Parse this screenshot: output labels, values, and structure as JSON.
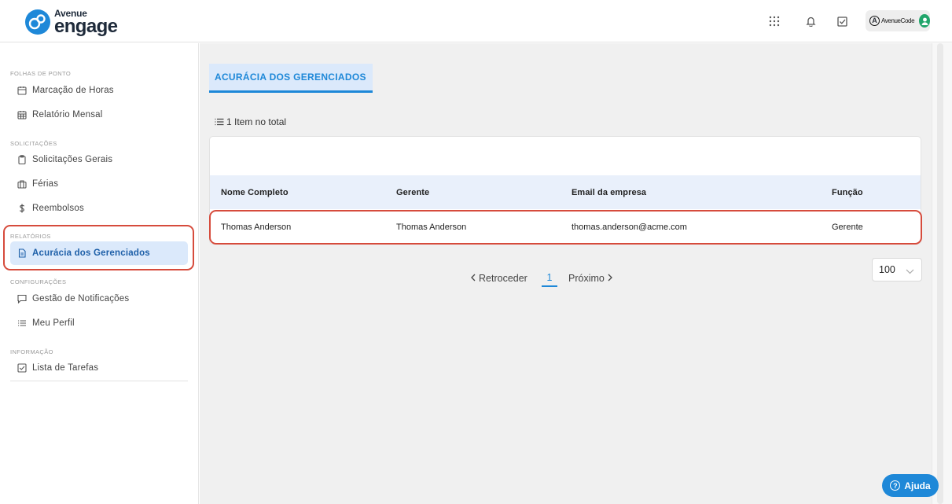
{
  "app": {
    "logo_small": "Avenue",
    "logo_big": "engage",
    "company_name": "AvenueCode",
    "company_initial": "A"
  },
  "sidebar": {
    "sections": [
      {
        "title": "FOLHAS DE PONTO",
        "items": [
          {
            "label": "Marcação de Horas",
            "icon": "calendar-icon"
          },
          {
            "label": "Relatório Mensal",
            "icon": "calendar-grid-icon"
          }
        ]
      },
      {
        "title": "SOLICITAÇÕES",
        "items": [
          {
            "label": "Solicitações Gerais",
            "icon": "clipboard-icon"
          },
          {
            "label": "Férias",
            "icon": "suitcase-icon"
          },
          {
            "label": "Reembolsos",
            "icon": "dollar-icon"
          }
        ]
      },
      {
        "title": "RELATÓRIOS",
        "items": [
          {
            "label": "Acurácia dos Gerenciados",
            "icon": "document-icon",
            "active": true
          }
        ]
      },
      {
        "title": "CONFIGURAÇÕES",
        "items": [
          {
            "label": "Gestão de Notificações",
            "icon": "message-icon"
          },
          {
            "label": "Meu Perfil",
            "icon": "list-icon"
          }
        ]
      },
      {
        "title": "INFORMAÇÃO",
        "items": [
          {
            "label": "Lista de Tarefas",
            "icon": "checkbox-icon"
          }
        ]
      }
    ]
  },
  "main": {
    "tab_label": "ACURÁCIA DOS GERENCIADOS",
    "total_text": "1 Item no total",
    "table": {
      "columns": [
        "Nome Completo",
        "Gerente",
        "Email da empresa",
        "Função"
      ],
      "rows": [
        [
          "Thomas Anderson",
          "Thomas Anderson",
          "thomas.anderson@acme.com",
          "Gerente"
        ]
      ]
    },
    "pagination": {
      "prev_label": "Retroceder",
      "current_page": "1",
      "next_label": "Próximo",
      "page_size": "100"
    }
  },
  "help": {
    "label": "Ajuda",
    "icon_text": "?"
  },
  "colors": {
    "accent": "#1e88d8",
    "active_bg": "#dbe9fb",
    "highlight": "#d64b3c",
    "avatar": "#21a56b"
  }
}
